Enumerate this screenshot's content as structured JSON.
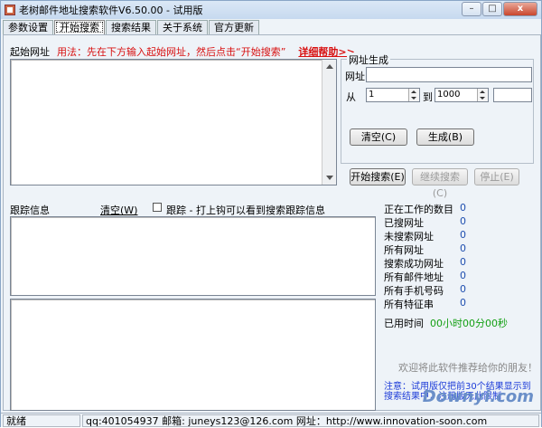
{
  "window": {
    "title": "老树邮件地址搜索软件V6.50.00 - 试用版",
    "min": "–",
    "max": "□",
    "close": "x"
  },
  "tabs": [
    "参数设置",
    "开始搜索",
    "搜索结果",
    "关于系统",
    "官方更新"
  ],
  "hint": {
    "label": "起始网址",
    "usage": "用法：先在下方输入起始网址，然后点击“开始搜索”",
    "help_link": "详细帮助>>"
  },
  "gen": {
    "group_title": "网址生成",
    "url_label": "网址",
    "url_value": "",
    "from_label": "从",
    "from_value": "1",
    "to_label": "到",
    "to_value": "1000",
    "extra_value": "",
    "clear_btn": "清空(C)",
    "gen_btn": "生成(B)"
  },
  "actions": {
    "start": "开始搜索(E)",
    "resume": "继续搜索(C)",
    "stop": "停止(E)"
  },
  "trace": {
    "label": "跟踪信息",
    "clear": "清空(W)",
    "checkbox_label": "跟踪 - 打上钩可以看到搜索跟踪信息"
  },
  "stats": [
    {
      "label": "正在工作的数目",
      "value": "0"
    },
    {
      "label": "已搜网址",
      "value": "0"
    },
    {
      "label": "未搜索网址",
      "value": "0"
    },
    {
      "label": "所有网址",
      "value": "0"
    },
    {
      "label": "搜索成功网址",
      "value": "0"
    },
    {
      "label": "所有邮件地址",
      "value": "0"
    },
    {
      "label": "所有手机号码",
      "value": "0"
    },
    {
      "label": "所有特征串",
      "value": "0"
    }
  ],
  "timer": {
    "label": "已用时间",
    "value": "00小时00分00秒"
  },
  "promo": "欢迎将此软件推荐给你的朋友！",
  "notice": "注意：试用版仅把前30个结果显示到搜索结果中，注册版无此限制",
  "status": {
    "state": "就绪",
    "contact": "qq:401054937 邮箱: juneys123@126.com 网址：http://www.innovation-soon.com"
  },
  "watermark": "Downyi.com"
}
